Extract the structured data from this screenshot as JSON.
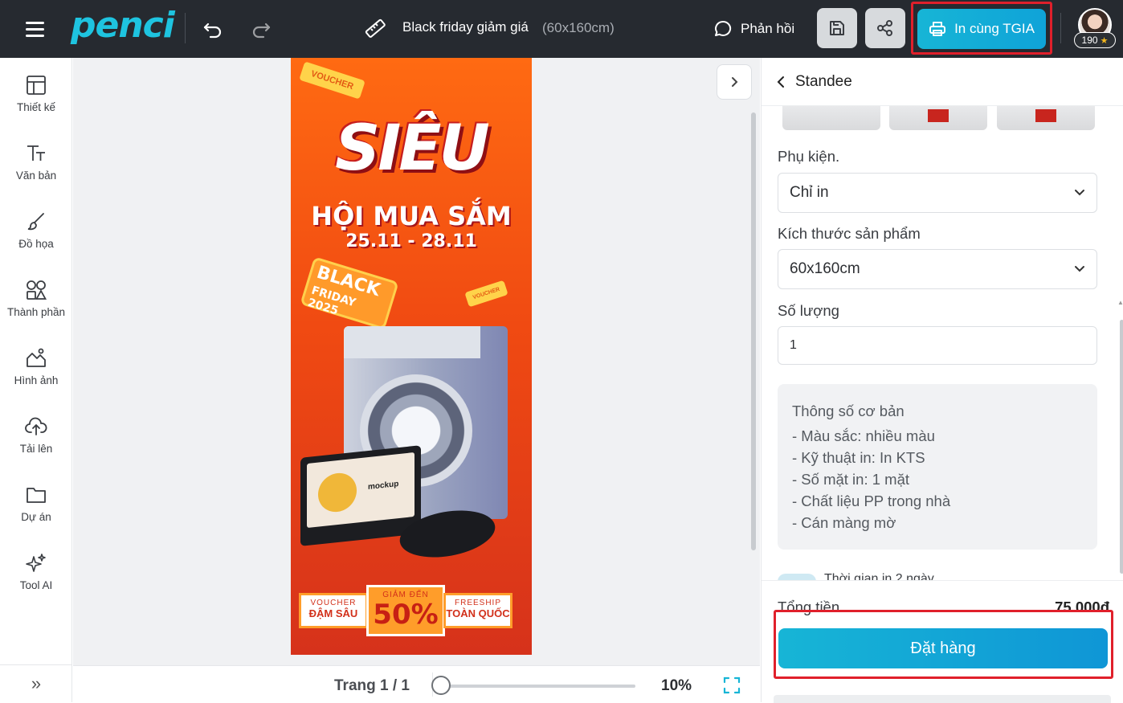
{
  "header": {
    "logo": "penci",
    "doc_title": "Black friday giảm giá",
    "doc_size": "(60x160cm)",
    "feedback_label": "Phản hồi",
    "print_label": "In cùng TGIA",
    "points": "190",
    "accent": "#1ec4e0",
    "bg": "#262a30"
  },
  "rail": {
    "items": [
      {
        "label": "Thiết kế",
        "icon": "layout-icon"
      },
      {
        "label": "Văn bản",
        "icon": "text-icon"
      },
      {
        "label": "Đồ họa",
        "icon": "brush-icon"
      },
      {
        "label": "Thành phần",
        "icon": "shapes-icon"
      },
      {
        "label": "Hình ảnh",
        "icon": "image-icon"
      },
      {
        "label": "Tải lên",
        "icon": "upload-icon"
      },
      {
        "label": "Dự án",
        "icon": "folder-icon"
      },
      {
        "label": "Tool AI",
        "icon": "sparkle-icon"
      }
    ],
    "expand": "»"
  },
  "poster": {
    "voucher_top": "VOUCHER",
    "headline_1": "SIÊU",
    "headline_2": "HỘI MUA SẮM",
    "dates": "25.11 - 28.11",
    "bf_1": "BLACK",
    "bf_2": "FRIDAY 2025",
    "voucher_small": "VOUCHER",
    "promo_1_small": "VOUCHER",
    "promo_1_big": "ĐẬM SÂU",
    "promo_2_small": "GIẢM ĐẾN",
    "promo_2_big": "50%",
    "promo_3_small": "FREESHIP",
    "promo_3_big": "TOÀN QUỐC",
    "laptop_text": "mockup"
  },
  "status": {
    "page": "Trang 1 / 1",
    "zoom": "10%"
  },
  "panel": {
    "title": "Standee",
    "accessory_label": "Phụ kiện.",
    "accessory_value": "Chỉ in",
    "size_label": "Kích thước sản phẩm",
    "size_value": "60x160cm",
    "qty_label": "Số lượng",
    "qty_value": "1",
    "specs_title": "Thông số cơ bản",
    "specs": [
      "- Màu sắc: nhiều màu",
      "- Kỹ thuật in: In KTS",
      "- Số mặt in: 1 mặt",
      "- Chất liệu PP trong nhà",
      "- Cán màng mờ"
    ],
    "delivery": "Thời gian in 2 ngày",
    "total_label": "Tổng tiền",
    "total_value": "75.000đ",
    "order_label": "Đặt hàng"
  }
}
